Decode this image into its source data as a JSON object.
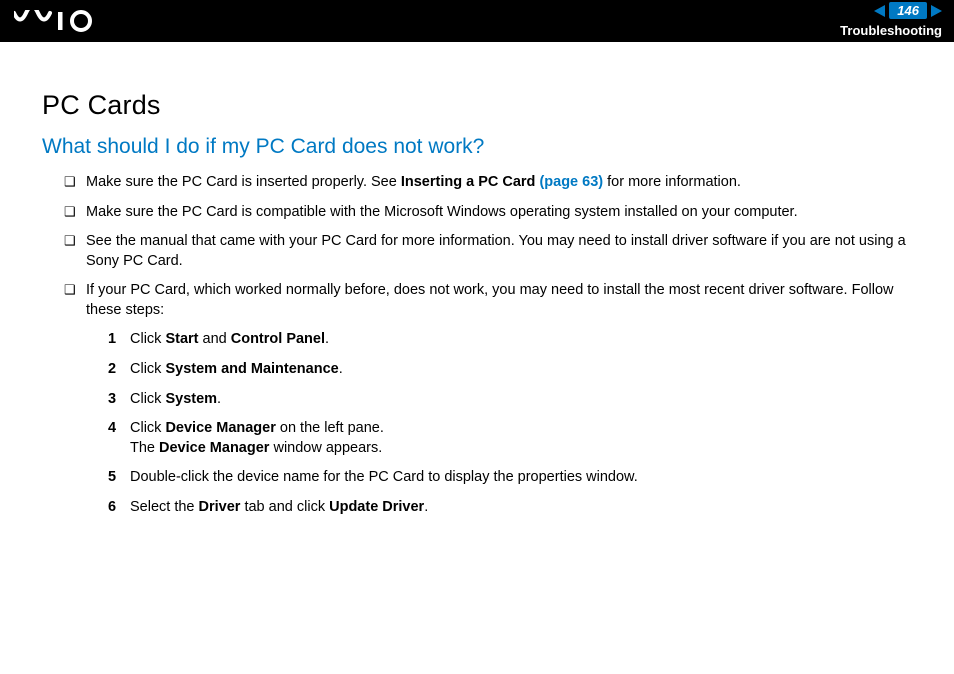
{
  "header": {
    "page_number": "146",
    "section": "Troubleshooting"
  },
  "title": "PC Cards",
  "question": "What should I do if my PC Card does not work?",
  "bullets": [
    {
      "pre": "Make sure the PC Card is inserted properly. See ",
      "bold": "Inserting a PC Card ",
      "link": "(page 63)",
      "post": " for more information."
    },
    {
      "text": "Make sure the PC Card is compatible with the Microsoft Windows operating system installed on your computer."
    },
    {
      "text": "See the manual that came with your PC Card for more information. You may need to install driver software if you are not using a Sony PC Card."
    },
    {
      "text": "If your PC Card, which worked normally before, does not work, you may need to install the most recent driver software. Follow these steps:"
    }
  ],
  "steps": [
    {
      "n": "1",
      "pre": "Click ",
      "b1": "Start",
      "mid": " and ",
      "b2": "Control Panel",
      "post": "."
    },
    {
      "n": "2",
      "pre": "Click ",
      "b1": "System and Maintenance",
      "post": "."
    },
    {
      "n": "3",
      "pre": "Click ",
      "b1": "System",
      "post": "."
    },
    {
      "n": "4",
      "pre": "Click ",
      "b1": "Device Manager",
      "mid": " on the left pane.",
      "line2_pre": "The ",
      "line2_b": "Device Manager",
      "line2_post": " window appears."
    },
    {
      "n": "5",
      "text": "Double-click the device name for the PC Card to display the properties window."
    },
    {
      "n": "6",
      "pre": "Select the ",
      "b1": "Driver",
      "mid": " tab and click ",
      "b2": "Update Driver",
      "post": "."
    }
  ]
}
